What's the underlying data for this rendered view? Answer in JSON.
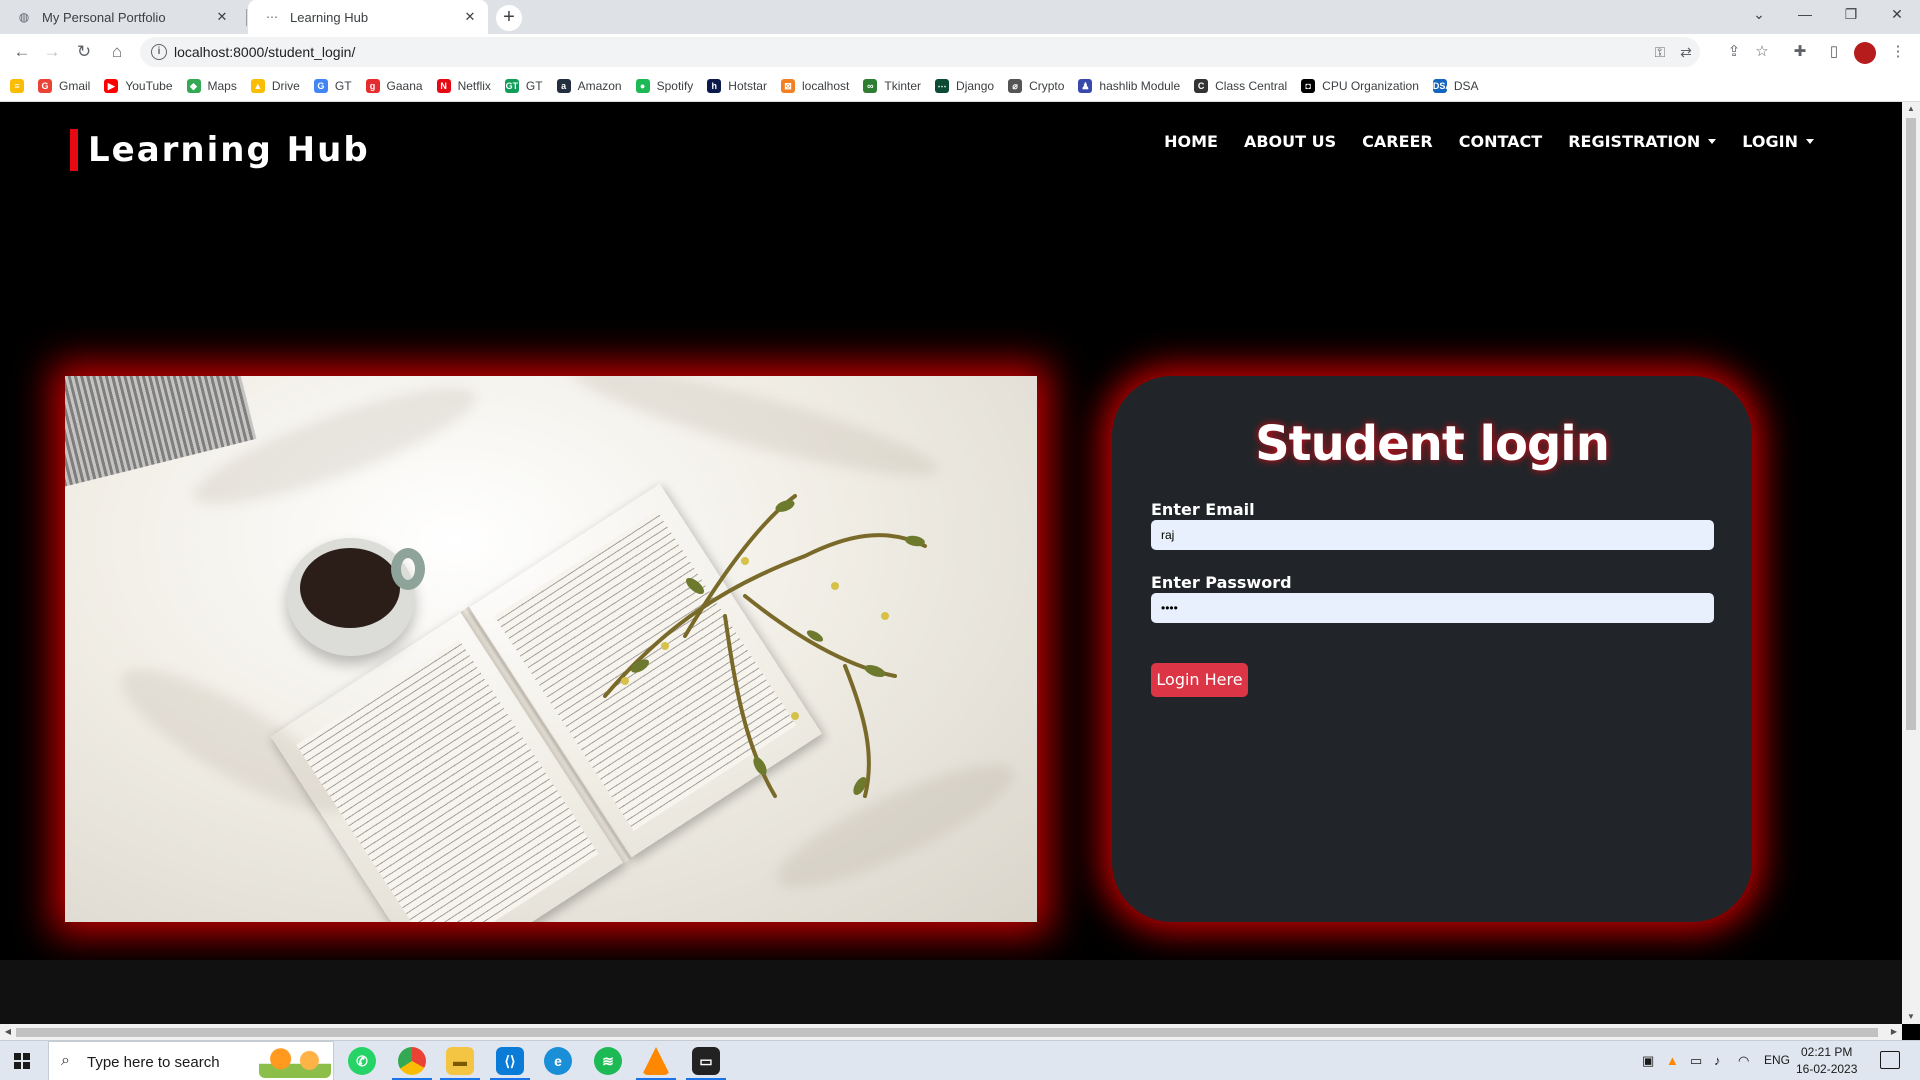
{
  "browser": {
    "tabs": [
      {
        "title": "My Personal Portfolio",
        "active": false
      },
      {
        "title": "Learning Hub",
        "active": true
      }
    ],
    "url": "localhost:8000/student_login/",
    "bookmarks": [
      "Gmail",
      "YouTube",
      "Maps",
      "Drive",
      "GT",
      "Gaana",
      "Netflix",
      "GT",
      "Amazon",
      "Spotify",
      "Hotstar",
      "localhost",
      "Tkinter",
      "Django",
      "Crypto",
      "hashlib Module",
      "Class Central",
      "CPU Organization",
      "DSA"
    ],
    "bookmark_colors": [
      "#ea4335",
      "#ff0000",
      "#34a853",
      "#fbbc04",
      "#4285f4",
      "#e72c30",
      "#e50914",
      "#0f9d58",
      "#232f3e",
      "#1db954",
      "#0c1a4b",
      "#f48024",
      "#2e7d32",
      "#0c4b33",
      "#555555",
      "#3949ab",
      "#333333",
      "#000000",
      "#1565c0"
    ],
    "bookmark_badges": [
      "G",
      "▶",
      "◆",
      "▲",
      "G",
      "g",
      "N",
      "GT",
      "a",
      "●",
      "h",
      "⊠",
      "∞",
      "⋯",
      "⌀",
      "♟",
      "C",
      "◘",
      "DSA"
    ]
  },
  "site": {
    "brand": "Learning Hub",
    "accent": "#e50914",
    "nav": {
      "home": "HOME",
      "about": "ABOUT US",
      "career": "CAREER",
      "contact": "CONTACT",
      "registration": "REGISTRATION",
      "login": "LOGIN"
    }
  },
  "login": {
    "title": "Student login",
    "email_label": "Enter Email",
    "email_value": "raj",
    "password_label": "Enter Password",
    "password_value": "••••",
    "submit": "Login Here",
    "button_color": "#dc3545"
  },
  "taskbar": {
    "search_placeholder": "Type here to search",
    "language": "ENG",
    "time": "02:21 PM",
    "date": "16-02-2023"
  }
}
